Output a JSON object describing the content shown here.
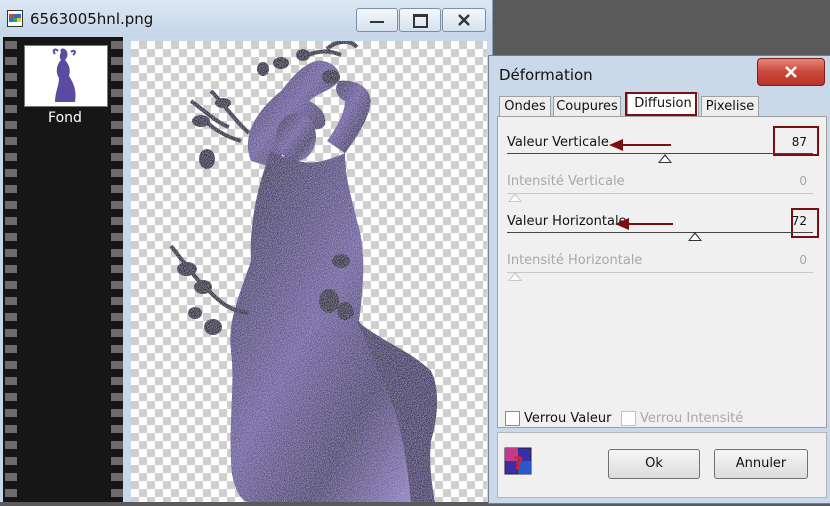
{
  "image_window": {
    "title": "6563005hnl.png",
    "controls": {
      "minimize": "–",
      "maximize": "▢",
      "close": "✕"
    },
    "layers": [
      {
        "label": "Fond"
      }
    ]
  },
  "dialog": {
    "title": "Déformation",
    "tabs": [
      {
        "label": "Ondes",
        "active": false
      },
      {
        "label": "Coupures",
        "active": false
      },
      {
        "label": "Diffusion",
        "active": true
      },
      {
        "label": "Pixelise",
        "active": false
      }
    ],
    "sliders": [
      {
        "label": "Valeur Verticale",
        "value": "87",
        "enabled": true,
        "level": 0.46
      },
      {
        "label": "Intensité Verticale",
        "value": "0",
        "enabled": false,
        "level": 0.0
      },
      {
        "label": "Valeur Horizontale",
        "value": "72",
        "enabled": true,
        "level": 0.62
      },
      {
        "label": "Intensité Horizontale",
        "value": "0",
        "enabled": false,
        "level": 0.0
      }
    ],
    "checkboxes": [
      {
        "label": "Verrou Valeur",
        "checked": false,
        "enabled": true
      },
      {
        "label": "Verrou Intensité",
        "checked": false,
        "enabled": false
      }
    ],
    "buttons": {
      "ok": "Ok",
      "cancel": "Annuler"
    }
  },
  "colors": {
    "annotation": "#7a0f0f",
    "dialog_close": "#c9473b",
    "silhouette_dark": "#1c1638",
    "silhouette_light": "#8a79c4"
  }
}
